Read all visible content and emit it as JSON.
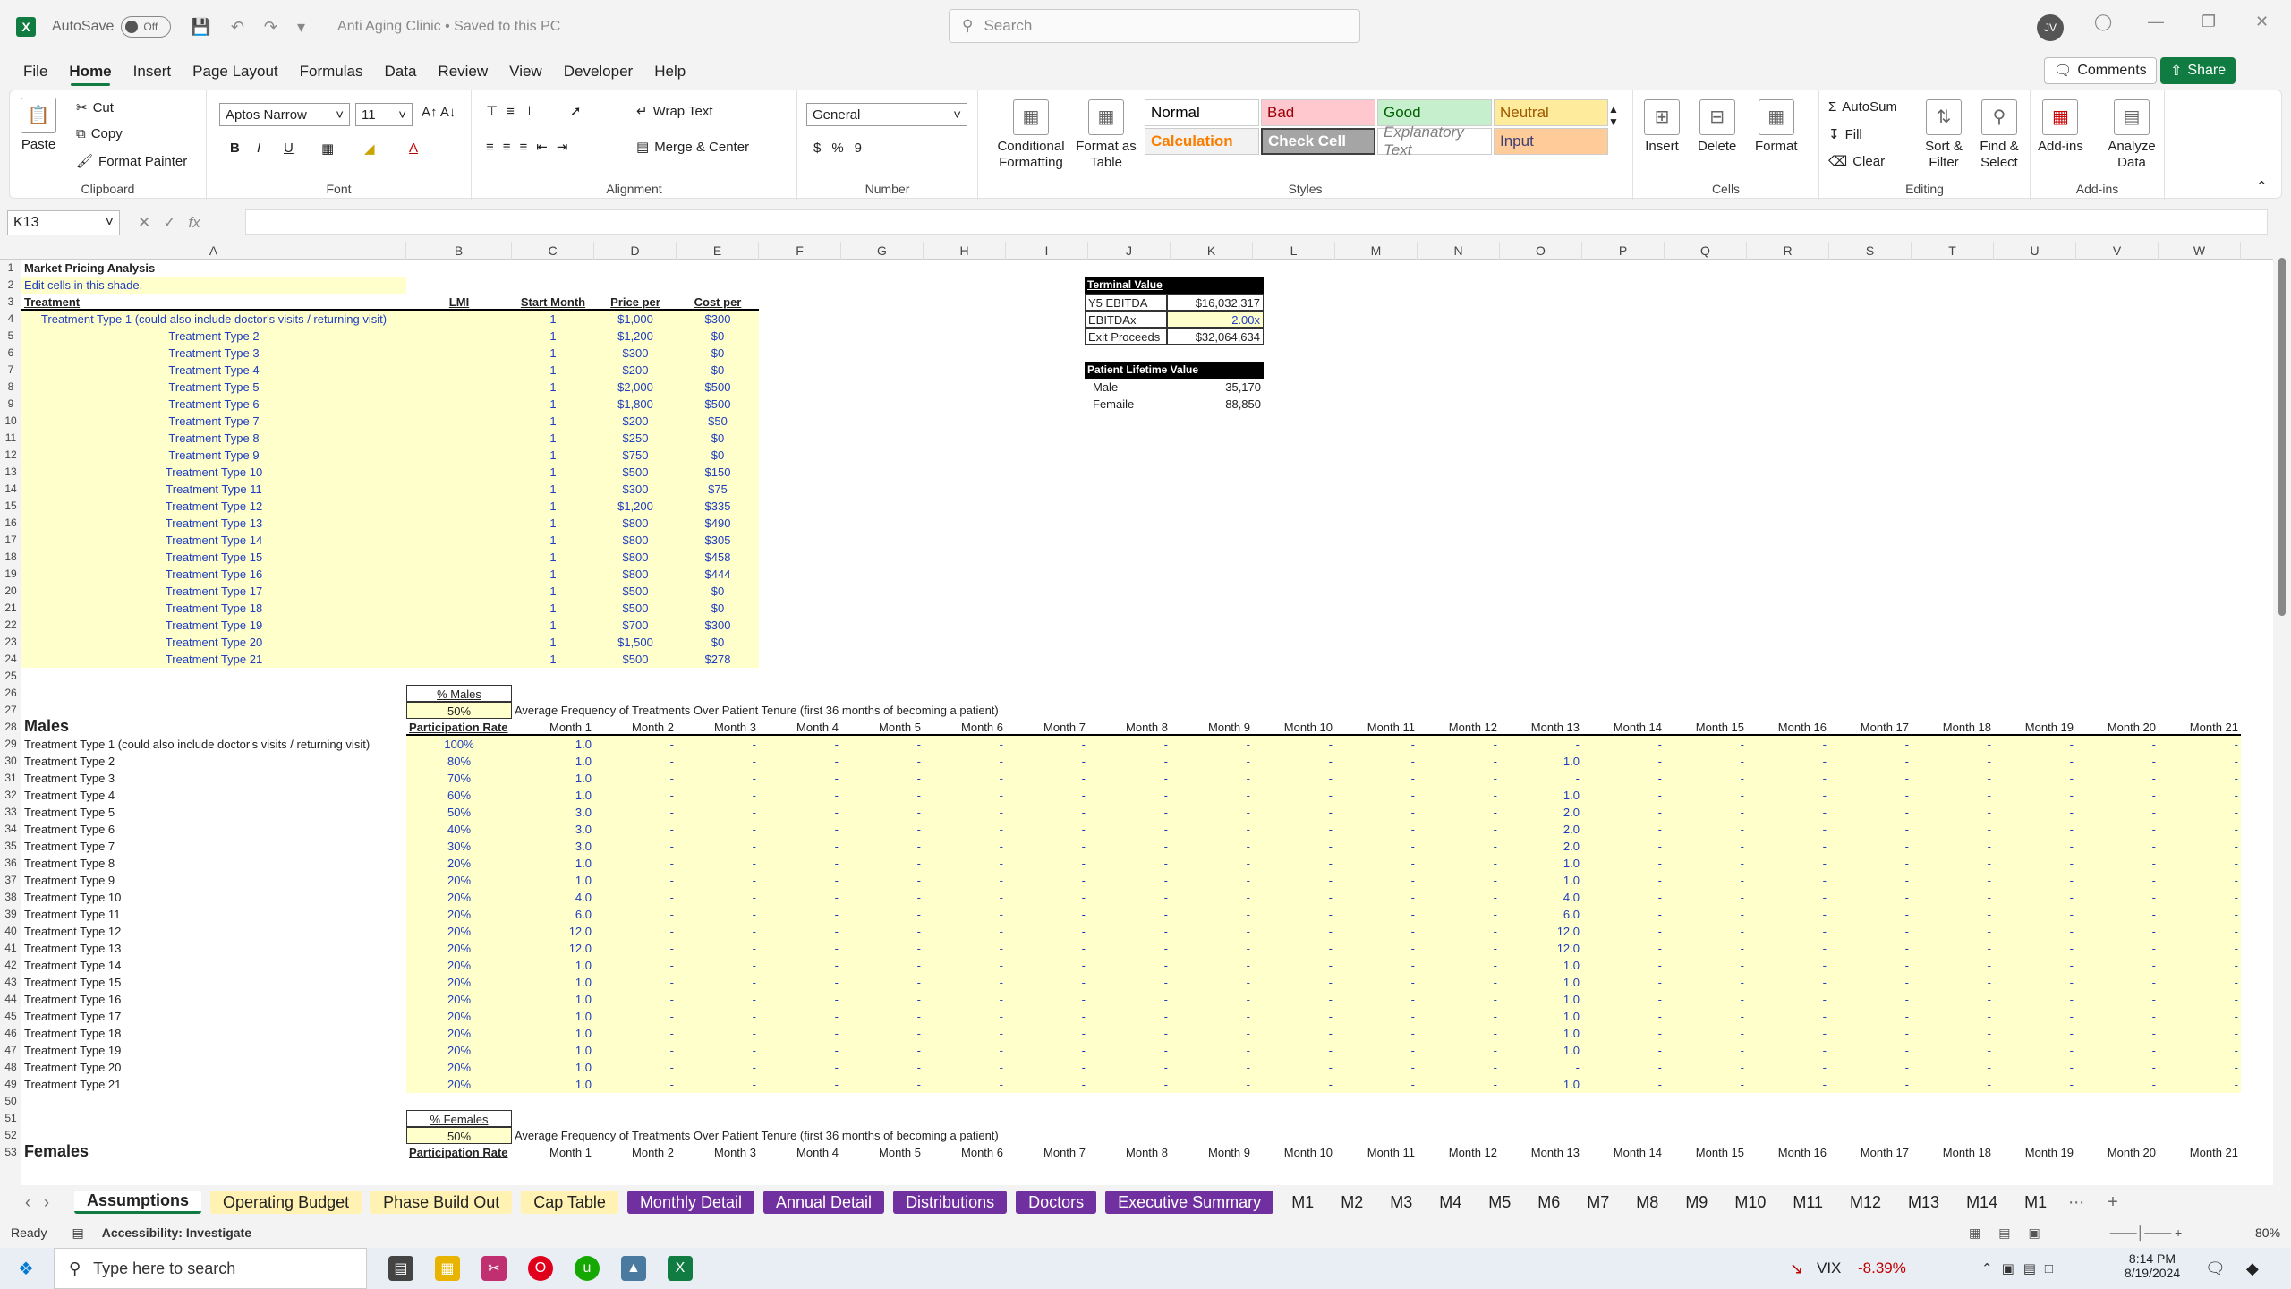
{
  "titlebar": {
    "autosave_label": "AutoSave",
    "autosave_state": "Off",
    "doc_title": "Anti Aging Clinic • Saved to this PC",
    "search_placeholder": "Search",
    "avatar_initials": "JV"
  },
  "menu": [
    "File",
    "Home",
    "Insert",
    "Page Layout",
    "Formulas",
    "Data",
    "Review",
    "View",
    "Developer",
    "Help"
  ],
  "header_buttons": {
    "comments": "Comments",
    "share": "Share"
  },
  "ribbon": {
    "clipboard": {
      "label": "Clipboard",
      "paste": "Paste",
      "cut": "Cut",
      "copy": "Copy",
      "format_painter": "Format Painter"
    },
    "font": {
      "label": "Font",
      "name": "Aptos Narrow",
      "size": "11"
    },
    "alignment": {
      "label": "Alignment",
      "wrap": "Wrap Text",
      "merge": "Merge & Center"
    },
    "number": {
      "label": "Number",
      "format": "General"
    },
    "styles": {
      "label": "Styles",
      "conditional": "Conditional Formatting",
      "format_table": "Format as Table",
      "cells": [
        {
          "name": "Normal",
          "bg": "#ffffff",
          "fg": "#000000"
        },
        {
          "name": "Bad",
          "bg": "#ffc7ce",
          "fg": "#9c0006"
        },
        {
          "name": "Good",
          "bg": "#c6efce",
          "fg": "#006100"
        },
        {
          "name": "Neutral",
          "bg": "#ffeb9c",
          "fg": "#9c5700"
        },
        {
          "name": "Calculation",
          "bg": "#f2f2f2",
          "fg": "#fa7d00"
        },
        {
          "name": "Check Cell",
          "bg": "#a5a5a5",
          "fg": "#ffffff"
        },
        {
          "name": "Explanatory Text",
          "bg": "#ffffff",
          "fg": "#7f7f7f"
        },
        {
          "name": "Input",
          "bg": "#ffcc99",
          "fg": "#3f3f76"
        }
      ]
    },
    "cells": {
      "label": "Cells",
      "insert": "Insert",
      "delete": "Delete",
      "format": "Format"
    },
    "editing": {
      "label": "Editing",
      "autosum": "AutoSum",
      "fill": "Fill",
      "clear": "Clear",
      "sort": "Sort & Filter",
      "find": "Find & Select"
    },
    "addins": {
      "label": "Add-ins",
      "addins": "Add-ins",
      "analyze": "Analyze Data"
    }
  },
  "formula_bar": {
    "cell": "K13",
    "fx": "fx",
    "value": ""
  },
  "columns": [
    "A",
    "B",
    "C",
    "D",
    "E",
    "F",
    "G",
    "H",
    "I",
    "J",
    "K",
    "L",
    "M",
    "N",
    "O",
    "P",
    "Q",
    "R",
    "S",
    "T",
    "U",
    "V",
    "W"
  ],
  "sheet": {
    "title": "Market Pricing Analysis",
    "edit_note": "Edit cells in this shade.",
    "headers": {
      "treatment": "Treatment",
      "lmi": "LMI",
      "start": "Start Month",
      "price": "Price per",
      "cost": "Cost per"
    },
    "treatments": [
      {
        "name": "Treatment Type 1 (could also include doctor's visits / returning visit)",
        "start": "1",
        "price": "$1,000",
        "cost": "$300"
      },
      {
        "name": "Treatment Type 2",
        "start": "1",
        "price": "$1,200",
        "cost": "$0"
      },
      {
        "name": "Treatment Type 3",
        "start": "1",
        "price": "$300",
        "cost": "$0"
      },
      {
        "name": "Treatment Type 4",
        "start": "1",
        "price": "$200",
        "cost": "$0"
      },
      {
        "name": "Treatment Type 5",
        "start": "1",
        "price": "$2,000",
        "cost": "$500"
      },
      {
        "name": "Treatment Type 6",
        "start": "1",
        "price": "$1,800",
        "cost": "$500"
      },
      {
        "name": "Treatment Type 7",
        "start": "1",
        "price": "$200",
        "cost": "$50"
      },
      {
        "name": "Treatment Type 8",
        "start": "1",
        "price": "$250",
        "cost": "$0"
      },
      {
        "name": "Treatment Type 9",
        "start": "1",
        "price": "$750",
        "cost": "$0"
      },
      {
        "name": "Treatment Type 10",
        "start": "1",
        "price": "$500",
        "cost": "$150"
      },
      {
        "name": "Treatment Type 11",
        "start": "1",
        "price": "$300",
        "cost": "$75"
      },
      {
        "name": "Treatment Type 12",
        "start": "1",
        "price": "$1,200",
        "cost": "$335"
      },
      {
        "name": "Treatment Type 13",
        "start": "1",
        "price": "$800",
        "cost": "$490"
      },
      {
        "name": "Treatment Type 14",
        "start": "1",
        "price": "$800",
        "cost": "$305"
      },
      {
        "name": "Treatment Type 15",
        "start": "1",
        "price": "$800",
        "cost": "$458"
      },
      {
        "name": "Treatment Type 16",
        "start": "1",
        "price": "$800",
        "cost": "$444"
      },
      {
        "name": "Treatment Type 17",
        "start": "1",
        "price": "$500",
        "cost": "$0"
      },
      {
        "name": "Treatment Type 18",
        "start": "1",
        "price": "$500",
        "cost": "$0"
      },
      {
        "name": "Treatment Type 19",
        "start": "1",
        "price": "$700",
        "cost": "$300"
      },
      {
        "name": "Treatment Type 20",
        "start": "1",
        "price": "$1,500",
        "cost": "$0"
      },
      {
        "name": "Treatment Type 21",
        "start": "1",
        "price": "$500",
        "cost": "$278"
      }
    ],
    "terminal": {
      "title": "Terminal Value",
      "rows": [
        {
          "k": "Y5 EBITDA",
          "v": "$16,032,317"
        },
        {
          "k": "EBITDAx",
          "v": "2.00x"
        },
        {
          "k": "Exit Proceeds",
          "v": "$32,064,634"
        }
      ]
    },
    "lifetime": {
      "title": "Patient Lifetime Value",
      "rows": [
        {
          "k": "Male",
          "v": "35,170"
        },
        {
          "k": "Femaile",
          "v": "88,850"
        }
      ]
    },
    "males": {
      "pct_label": "% Males",
      "pct": "50%",
      "freq_note": "Average Frequency of Treatments Over Patient Tenure (first 36 months of becoming a patient)",
      "section": "Males",
      "part_header": "Participation Rate",
      "rates": [
        "100%",
        "80%",
        "70%",
        "60%",
        "50%",
        "40%",
        "30%",
        "20%",
        "20%",
        "20%",
        "20%",
        "20%",
        "20%",
        "20%",
        "20%",
        "20%",
        "20%",
        "20%",
        "20%",
        "20%",
        "20%"
      ],
      "m1": [
        "1.0",
        "1.0",
        "1.0",
        "1.0",
        "3.0",
        "3.0",
        "3.0",
        "1.0",
        "1.0",
        "4.0",
        "6.0",
        "12.0",
        "12.0",
        "1.0",
        "1.0",
        "1.0",
        "1.0",
        "1.0",
        "1.0",
        "1.0",
        "1.0"
      ],
      "m13": [
        "-",
        "1.0",
        "-",
        "1.0",
        "2.0",
        "2.0",
        "2.0",
        "1.0",
        "1.0",
        "4.0",
        "6.0",
        "12.0",
        "12.0",
        "1.0",
        "1.0",
        "1.0",
        "1.0",
        "1.0",
        "1.0",
        "-",
        "1.0"
      ]
    },
    "females": {
      "pct_label": "% Females",
      "pct": "50%",
      "freq_note": "Average Frequency of Treatments Over Patient Tenure (first 36 months of becoming a patient)",
      "section": "Females",
      "part_header": "Participation Rate"
    },
    "months": [
      "Month 1",
      "Month 2",
      "Month 3",
      "Month 4",
      "Month 5",
      "Month 6",
      "Month 7",
      "Month 8",
      "Month 9",
      "Month 10",
      "Month 11",
      "Month 12",
      "Month 13",
      "Month 14",
      "Month 15",
      "Month 16",
      "Month 17",
      "Month 18",
      "Month 19",
      "Month 20",
      "Month 21"
    ],
    "dash": "-"
  },
  "tabs": [
    {
      "name": "Assumptions",
      "style": "active"
    },
    {
      "name": "Operating Budget",
      "style": "yellow"
    },
    {
      "name": "Phase Build Out",
      "style": "yellow"
    },
    {
      "name": "Cap Table",
      "style": "yellow"
    },
    {
      "name": "Monthly Detail",
      "style": "purple"
    },
    {
      "name": "Annual Detail",
      "style": "purple"
    },
    {
      "name": "Distributions",
      "style": "purple"
    },
    {
      "name": "Doctors",
      "style": "purple"
    },
    {
      "name": "Executive Summary",
      "style": "purple"
    },
    {
      "name": "M1",
      "style": "plain"
    },
    {
      "name": "M2",
      "style": "plain"
    },
    {
      "name": "M3",
      "style": "plain"
    },
    {
      "name": "M4",
      "style": "plain"
    },
    {
      "name": "M5",
      "style": "plain"
    },
    {
      "name": "M6",
      "style": "plain"
    },
    {
      "name": "M7",
      "style": "plain"
    },
    {
      "name": "M8",
      "style": "plain"
    },
    {
      "name": "M9",
      "style": "plain"
    },
    {
      "name": "M10",
      "style": "plain"
    },
    {
      "name": "M11",
      "style": "plain"
    },
    {
      "name": "M12",
      "style": "plain"
    },
    {
      "name": "M13",
      "style": "plain"
    },
    {
      "name": "M14",
      "style": "plain"
    },
    {
      "name": "M1",
      "style": "plain"
    }
  ],
  "status": {
    "ready": "Ready",
    "accessibility": "Accessibility: Investigate",
    "zoom": "80%"
  },
  "taskbar": {
    "search_placeholder": "Type here to search",
    "vix": "VIX",
    "vix_change": "-8.39%",
    "time": "8:14 PM",
    "date": "8/19/2024"
  }
}
